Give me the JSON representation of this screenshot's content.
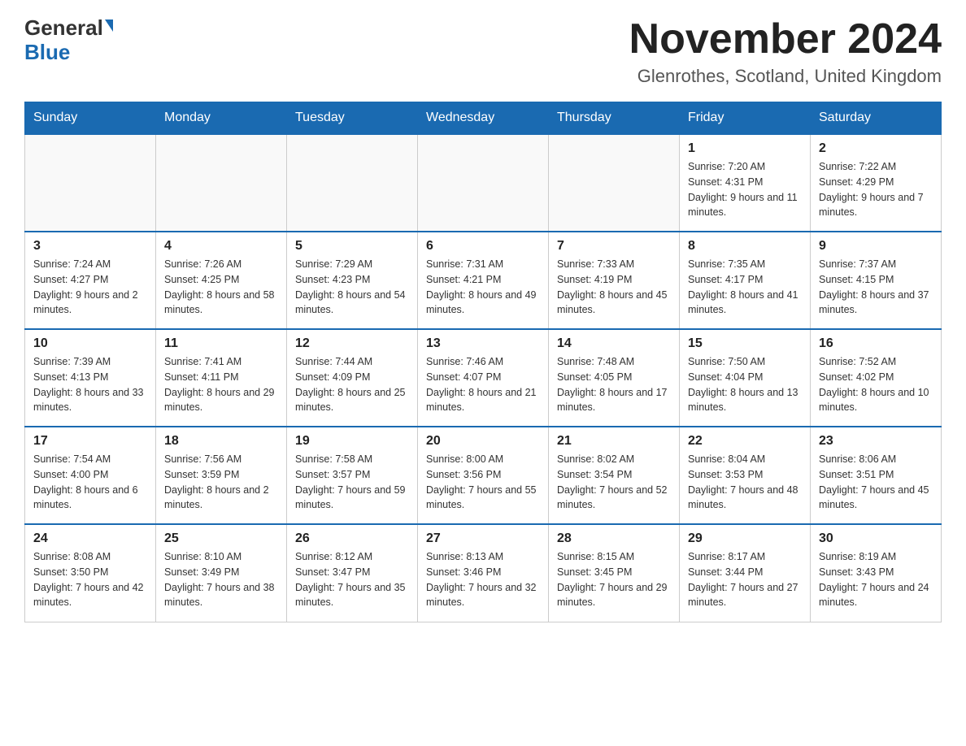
{
  "header": {
    "logo_general": "General",
    "logo_blue": "Blue",
    "month_title": "November 2024",
    "location": "Glenrothes, Scotland, United Kingdom"
  },
  "days_of_week": [
    "Sunday",
    "Monday",
    "Tuesday",
    "Wednesday",
    "Thursday",
    "Friday",
    "Saturday"
  ],
  "weeks": [
    [
      {
        "day": "",
        "sunrise": "",
        "sunset": "",
        "daylight": ""
      },
      {
        "day": "",
        "sunrise": "",
        "sunset": "",
        "daylight": ""
      },
      {
        "day": "",
        "sunrise": "",
        "sunset": "",
        "daylight": ""
      },
      {
        "day": "",
        "sunrise": "",
        "sunset": "",
        "daylight": ""
      },
      {
        "day": "",
        "sunrise": "",
        "sunset": "",
        "daylight": ""
      },
      {
        "day": "1",
        "sunrise": "Sunrise: 7:20 AM",
        "sunset": "Sunset: 4:31 PM",
        "daylight": "Daylight: 9 hours and 11 minutes."
      },
      {
        "day": "2",
        "sunrise": "Sunrise: 7:22 AM",
        "sunset": "Sunset: 4:29 PM",
        "daylight": "Daylight: 9 hours and 7 minutes."
      }
    ],
    [
      {
        "day": "3",
        "sunrise": "Sunrise: 7:24 AM",
        "sunset": "Sunset: 4:27 PM",
        "daylight": "Daylight: 9 hours and 2 minutes."
      },
      {
        "day": "4",
        "sunrise": "Sunrise: 7:26 AM",
        "sunset": "Sunset: 4:25 PM",
        "daylight": "Daylight: 8 hours and 58 minutes."
      },
      {
        "day": "5",
        "sunrise": "Sunrise: 7:29 AM",
        "sunset": "Sunset: 4:23 PM",
        "daylight": "Daylight: 8 hours and 54 minutes."
      },
      {
        "day": "6",
        "sunrise": "Sunrise: 7:31 AM",
        "sunset": "Sunset: 4:21 PM",
        "daylight": "Daylight: 8 hours and 49 minutes."
      },
      {
        "day": "7",
        "sunrise": "Sunrise: 7:33 AM",
        "sunset": "Sunset: 4:19 PM",
        "daylight": "Daylight: 8 hours and 45 minutes."
      },
      {
        "day": "8",
        "sunrise": "Sunrise: 7:35 AM",
        "sunset": "Sunset: 4:17 PM",
        "daylight": "Daylight: 8 hours and 41 minutes."
      },
      {
        "day": "9",
        "sunrise": "Sunrise: 7:37 AM",
        "sunset": "Sunset: 4:15 PM",
        "daylight": "Daylight: 8 hours and 37 minutes."
      }
    ],
    [
      {
        "day": "10",
        "sunrise": "Sunrise: 7:39 AM",
        "sunset": "Sunset: 4:13 PM",
        "daylight": "Daylight: 8 hours and 33 minutes."
      },
      {
        "day": "11",
        "sunrise": "Sunrise: 7:41 AM",
        "sunset": "Sunset: 4:11 PM",
        "daylight": "Daylight: 8 hours and 29 minutes."
      },
      {
        "day": "12",
        "sunrise": "Sunrise: 7:44 AM",
        "sunset": "Sunset: 4:09 PM",
        "daylight": "Daylight: 8 hours and 25 minutes."
      },
      {
        "day": "13",
        "sunrise": "Sunrise: 7:46 AM",
        "sunset": "Sunset: 4:07 PM",
        "daylight": "Daylight: 8 hours and 21 minutes."
      },
      {
        "day": "14",
        "sunrise": "Sunrise: 7:48 AM",
        "sunset": "Sunset: 4:05 PM",
        "daylight": "Daylight: 8 hours and 17 minutes."
      },
      {
        "day": "15",
        "sunrise": "Sunrise: 7:50 AM",
        "sunset": "Sunset: 4:04 PM",
        "daylight": "Daylight: 8 hours and 13 minutes."
      },
      {
        "day": "16",
        "sunrise": "Sunrise: 7:52 AM",
        "sunset": "Sunset: 4:02 PM",
        "daylight": "Daylight: 8 hours and 10 minutes."
      }
    ],
    [
      {
        "day": "17",
        "sunrise": "Sunrise: 7:54 AM",
        "sunset": "Sunset: 4:00 PM",
        "daylight": "Daylight: 8 hours and 6 minutes."
      },
      {
        "day": "18",
        "sunrise": "Sunrise: 7:56 AM",
        "sunset": "Sunset: 3:59 PM",
        "daylight": "Daylight: 8 hours and 2 minutes."
      },
      {
        "day": "19",
        "sunrise": "Sunrise: 7:58 AM",
        "sunset": "Sunset: 3:57 PM",
        "daylight": "Daylight: 7 hours and 59 minutes."
      },
      {
        "day": "20",
        "sunrise": "Sunrise: 8:00 AM",
        "sunset": "Sunset: 3:56 PM",
        "daylight": "Daylight: 7 hours and 55 minutes."
      },
      {
        "day": "21",
        "sunrise": "Sunrise: 8:02 AM",
        "sunset": "Sunset: 3:54 PM",
        "daylight": "Daylight: 7 hours and 52 minutes."
      },
      {
        "day": "22",
        "sunrise": "Sunrise: 8:04 AM",
        "sunset": "Sunset: 3:53 PM",
        "daylight": "Daylight: 7 hours and 48 minutes."
      },
      {
        "day": "23",
        "sunrise": "Sunrise: 8:06 AM",
        "sunset": "Sunset: 3:51 PM",
        "daylight": "Daylight: 7 hours and 45 minutes."
      }
    ],
    [
      {
        "day": "24",
        "sunrise": "Sunrise: 8:08 AM",
        "sunset": "Sunset: 3:50 PM",
        "daylight": "Daylight: 7 hours and 42 minutes."
      },
      {
        "day": "25",
        "sunrise": "Sunrise: 8:10 AM",
        "sunset": "Sunset: 3:49 PM",
        "daylight": "Daylight: 7 hours and 38 minutes."
      },
      {
        "day": "26",
        "sunrise": "Sunrise: 8:12 AM",
        "sunset": "Sunset: 3:47 PM",
        "daylight": "Daylight: 7 hours and 35 minutes."
      },
      {
        "day": "27",
        "sunrise": "Sunrise: 8:13 AM",
        "sunset": "Sunset: 3:46 PM",
        "daylight": "Daylight: 7 hours and 32 minutes."
      },
      {
        "day": "28",
        "sunrise": "Sunrise: 8:15 AM",
        "sunset": "Sunset: 3:45 PM",
        "daylight": "Daylight: 7 hours and 29 minutes."
      },
      {
        "day": "29",
        "sunrise": "Sunrise: 8:17 AM",
        "sunset": "Sunset: 3:44 PM",
        "daylight": "Daylight: 7 hours and 27 minutes."
      },
      {
        "day": "30",
        "sunrise": "Sunrise: 8:19 AM",
        "sunset": "Sunset: 3:43 PM",
        "daylight": "Daylight: 7 hours and 24 minutes."
      }
    ]
  ]
}
